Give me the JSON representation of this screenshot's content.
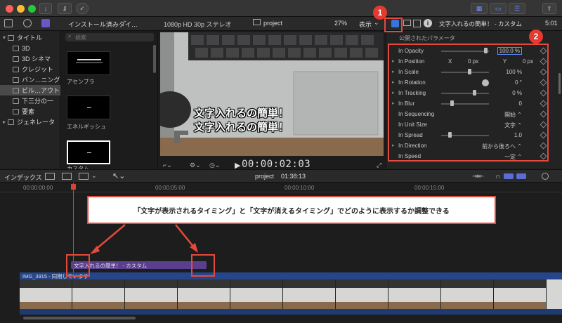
{
  "sidebar": {
    "items": [
      {
        "label": "タイトル",
        "level": 0
      },
      {
        "label": "3D",
        "level": 1
      },
      {
        "label": "3D シネマ",
        "level": 1
      },
      {
        "label": "クレジット",
        "level": 1
      },
      {
        "label": "バン…ニング",
        "level": 1
      },
      {
        "label": "ビル…アウト",
        "level": 1,
        "selected": true
      },
      {
        "label": "下三分の一",
        "level": 1
      },
      {
        "label": "要素",
        "level": 1
      },
      {
        "label": "ジェネレータ",
        "level": 0
      }
    ]
  },
  "browser": {
    "dropdown": "インストール済みタイ…",
    "search_placeholder": "検索",
    "items": [
      "アセンブラ",
      "エネルギッシュ",
      "カスタム"
    ]
  },
  "viewer": {
    "format": "1080p HD 30p ステレオ",
    "project_name": "project",
    "zoom": "27%",
    "view_label": "表示",
    "timecode": "00:00:02:03",
    "overlay_line1": "文字入れるの簡単！",
    "overlay_line2": "文字入れるの簡単！"
  },
  "inspector": {
    "header_title": "文字入れるの簡単！ - カスタム",
    "header_time": "5:01",
    "section_label": "公開されたパラメータ",
    "params": [
      {
        "name": "In Opacity",
        "value": "100.0 %",
        "slider": 0.95,
        "triangle": false
      },
      {
        "name": "In Position",
        "value": "0 px",
        "x_label": "X",
        "y_label": "Y",
        "value2": "0 px",
        "triangle": true
      },
      {
        "name": "In Scale",
        "value": "100 %",
        "slider": 0.6,
        "triangle": true
      },
      {
        "name": "In Rotation",
        "value": "0 °",
        "dial": true,
        "triangle": true
      },
      {
        "name": "In Tracking",
        "value": "0 %",
        "slider": 0.7,
        "triangle": true
      },
      {
        "name": "In Blur",
        "value": "0",
        "slider": 0.2,
        "triangle": true
      },
      {
        "name": "In Sequencing",
        "value": "開始 ⌃",
        "triangle": false
      },
      {
        "name": "In Unit Size",
        "value": "文字 ⌃",
        "triangle": false
      },
      {
        "name": "In Spread",
        "value": "1.0",
        "slider": 0.15,
        "triangle": false
      },
      {
        "name": "In Direction",
        "value": "前から後ろへ ⌃",
        "triangle": true
      },
      {
        "name": "In Speed",
        "value": "一定 ⌃",
        "triangle": false
      }
    ]
  },
  "timeline_bar": {
    "index_label": "インデックス",
    "project_label": "project",
    "duration": "01:38:13"
  },
  "ruler": {
    "ticks": [
      "00:00:00:00",
      "00:00:05:00",
      "00:00:10:00",
      "00:00:15:00"
    ]
  },
  "title_clip": {
    "label": "文字入れるの簡単！ - カスタム"
  },
  "video_clip": {
    "label": "IMG_3915 - 同期しています"
  },
  "annotation": {
    "text": "「文字が表示されるタイミング」と「文字が消えるタイミング」でどのように表示するか調整できる",
    "badge1": "1",
    "badge2": "2"
  },
  "colors": {
    "accent_red": "#e53a2f",
    "clip_purple": "#5b3f8f",
    "clip_blue": "#26468c"
  }
}
